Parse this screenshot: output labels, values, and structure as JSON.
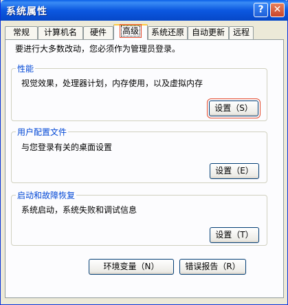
{
  "window": {
    "title": "系统属性"
  },
  "titlebar": {
    "help_label": "?",
    "close_label": "✕"
  },
  "tabs": [
    {
      "label": "常规"
    },
    {
      "label": "计算机名"
    },
    {
      "label": "硬件"
    },
    {
      "label": "高级"
    },
    {
      "label": "系统还原"
    },
    {
      "label": "自动更新"
    },
    {
      "label": "远程"
    }
  ],
  "intro_text": "要进行大多数改动，您必须作为管理员登录。",
  "groups": {
    "performance": {
      "label": "性能",
      "description": "视觉效果，处理器计划，内存使用，以及虚拟内存",
      "button": "设置（S）"
    },
    "user_profiles": {
      "label": "用户配置文件",
      "description": "与您登录有关的桌面设置",
      "button": "设置（E）"
    },
    "startup_recovery": {
      "label": "启动和故障恢复",
      "description": "系统启动，系统失败和调试信息",
      "button": "设置（T）"
    }
  },
  "bottom_buttons": {
    "env_vars": "环境变量（N）",
    "error_report": "错误报告（R）"
  }
}
